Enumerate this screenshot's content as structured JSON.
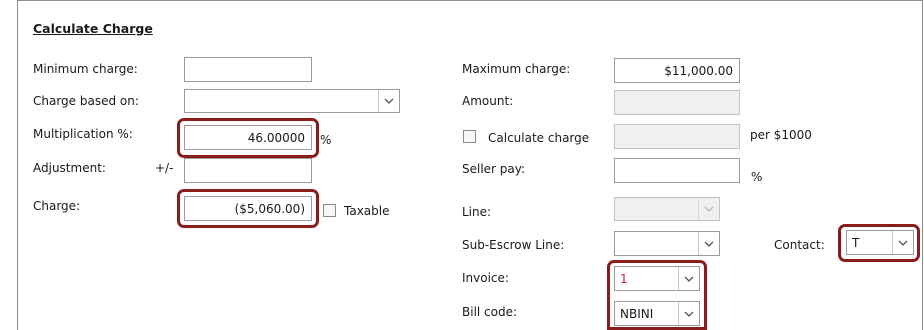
{
  "section": {
    "title": "Calculate Charge"
  },
  "left": {
    "min_charge_label": "Minimum charge:",
    "min_charge_value": "",
    "charge_based_on_label": "Charge based on:",
    "charge_based_on_value": "",
    "multiplication_label": "Multiplication %:",
    "multiplication_value": "46.00000",
    "multiplication_unit": "%",
    "adjustment_label": "Adjustment:",
    "adjustment_sign": "+/-",
    "adjustment_value": "",
    "charge_label": "Charge:",
    "charge_value": "($5,060.00)",
    "taxable_label": "Taxable",
    "taxable_checked": false
  },
  "right": {
    "max_charge_label": "Maximum charge:",
    "max_charge_value": "$11,000.00",
    "amount_label": "Amount:",
    "amount_value": "",
    "calc_charge_label": "Calculate charge",
    "calc_charge_checked": false,
    "calc_charge_value": "",
    "per_label": "per $1000",
    "seller_pay_label": "Seller pay:",
    "seller_pay_value": "",
    "seller_pay_unit": "%",
    "line_label": "Line:",
    "line_value": "",
    "sub_escrow_label": "Sub-Escrow Line:",
    "sub_escrow_value": "",
    "contact_label": "Contact:",
    "contact_value": "T",
    "invoice_label": "Invoice:",
    "invoice_value": "1",
    "bill_code_label": "Bill code:",
    "bill_code_value": "NBINI"
  },
  "colors": {
    "highlight": "#8b1c1c",
    "invoice_text": "#d0202a",
    "disabled_fill": "#f0f0f0"
  }
}
